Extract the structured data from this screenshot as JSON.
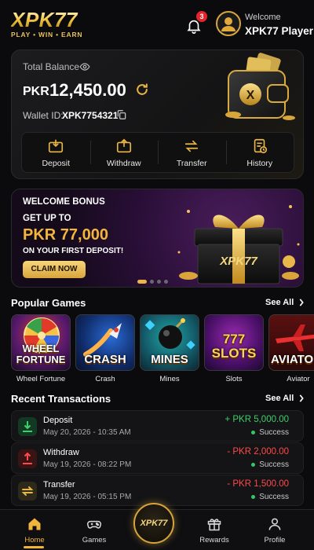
{
  "header": {
    "logo_main": "XPK77",
    "logo_tagline": "PLAY • WIN • EARN",
    "notification_count": "3",
    "welcome_label": "Welcome",
    "player_name": "XPK77 Player"
  },
  "balance": {
    "label": "Total Balance",
    "currency": "PKR",
    "amount": "12,450.00",
    "wallet_label": "Wallet ID:",
    "wallet_id": "XPK7754321",
    "actions": [
      {
        "label": "Deposit",
        "icon": "deposit-icon"
      },
      {
        "label": "Withdraw",
        "icon": "withdraw-icon"
      },
      {
        "label": "Transfer",
        "icon": "transfer-icon"
      },
      {
        "label": "History",
        "icon": "history-icon"
      }
    ]
  },
  "banner": {
    "title": "WELCOME BONUS",
    "line1": "GET UP TO",
    "amount": "PKR 77,000",
    "line2": "ON YOUR FIRST DEPOSIT!",
    "cta": "CLAIM NOW",
    "gift_text": "XPK77"
  },
  "popular_games": {
    "title": "Popular Games",
    "see_all": "See All",
    "items": [
      {
        "name": "Wheel Fortune",
        "art_text": "WHEEL FORTUNE"
      },
      {
        "name": "Crash",
        "art_text": "CRASH"
      },
      {
        "name": "Mines",
        "art_text": "MINES"
      },
      {
        "name": "Slots",
        "art_text": "777 SLOTS"
      },
      {
        "name": "Aviator",
        "art_text": "AVIATO"
      }
    ]
  },
  "transactions": {
    "title": "Recent Transactions",
    "see_all": "See All",
    "items": [
      {
        "type": "Deposit",
        "date": "May 20, 2026 - 10:35 AM",
        "amount": "+ PKR 5,000.00",
        "status": "Success",
        "color": "#3ecf6a"
      },
      {
        "type": "Withdraw",
        "date": "May 19, 2026 - 08:22 PM",
        "amount": "- PKR 2,000.00",
        "status": "Success",
        "color": "#ff4a4a"
      },
      {
        "type": "Transfer",
        "date": "May 19, 2026 - 05:15 PM",
        "amount": "- PKR 1,500.00",
        "status": "Success",
        "color": "#ff4a4a"
      }
    ]
  },
  "nav": {
    "home": "Home",
    "games": "Games",
    "center": "XPK77",
    "rewards": "Rewards",
    "profile": "Profile"
  },
  "colors": {
    "accent": "#f0b43c",
    "background": "#0b0b0d"
  }
}
